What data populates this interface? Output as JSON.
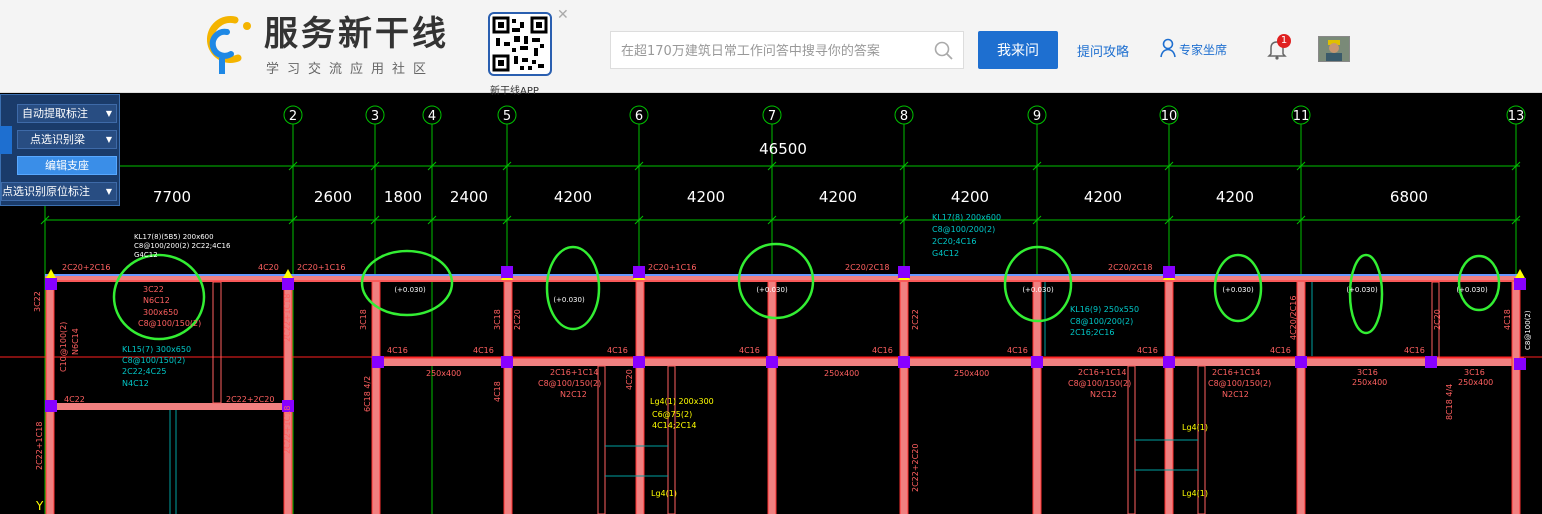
{
  "header": {
    "brand_name": "服务新干线",
    "brand_sub": "学习交流应用社区",
    "qr_label": "新干线APP",
    "search_placeholder": "在超170万建筑日常工作问答中搜寻你的答案",
    "ask_label": "我来问",
    "guide_label": "提问攻略",
    "expert_label": "专家坐席",
    "notify_count": "1"
  },
  "tool_panel": {
    "items": [
      {
        "label": "自动提取标注",
        "has_dropdown": true
      },
      {
        "label": "点选识别梁",
        "has_dropdown": true
      },
      {
        "label": "编辑支座",
        "has_dropdown": false
      },
      {
        "label": "点选识别原位标注",
        "has_dropdown": true
      }
    ]
  },
  "cad": {
    "colors": {
      "grid": "#00c000",
      "beam": "#ff3030",
      "beam_fill": "#f08080",
      "beam_top": "#6699ff",
      "support": "#ffff00",
      "column": "#8800ff",
      "circle": "#33ee33",
      "cyan": "#00c8c8"
    },
    "axes": [
      "2",
      "3",
      "4",
      "5",
      "6",
      "7",
      "8",
      "9",
      "10",
      "11",
      "13"
    ],
    "total_dim": "46500",
    "span_dims": [
      "7700",
      "2600",
      "1800",
      "2400",
      "4200",
      "4200",
      "4200",
      "4200",
      "4200",
      "4200",
      "6800"
    ],
    "top_labels": [
      "2C20+2C16",
      "4C20",
      "2C20+1C16",
      "2C20+1C16",
      "2C20/2C18",
      "2C20/2C18"
    ],
    "elevations": [
      "(+0.030)",
      "(+0.030)",
      "(+0.030)",
      "(+0.030)",
      "(+0.030)",
      "(+0.030)",
      "(+0.030)"
    ],
    "annot_left": [
      "3C22",
      "N6C12",
      "300x650",
      "C8@100/150(2)"
    ],
    "kl_top": [
      "KL17(8) 200x600",
      "C8@100/200(2)",
      "2C20;4C16",
      "G4C12"
    ],
    "kl_15": [
      "KL15(7) 300x650",
      "C8@100/150(2)",
      "2C22;4C25",
      "N4C12"
    ],
    "kl_16": [
      "KL16(9) 250x550",
      "C8@100/200(2)",
      "2C16;2C16"
    ],
    "kl_17": [
      "KL17(8)(5B5) 200x600",
      "C8@100/200(2) 2C22;4C16",
      "G4C12"
    ],
    "mid_labels": [
      "4C16",
      "4C16",
      "4C16",
      "4C16",
      "4C16",
      "4C16",
      "4C16",
      "4C16",
      "4C16"
    ],
    "section_labels": [
      "250x400",
      "250x400",
      "250x400",
      "250x400",
      "250x400"
    ],
    "mid_annots": [
      [
        "2C16+1C14",
        "C8@100/150(2)",
        "N2C12"
      ],
      [
        "2C16+1C14",
        "C8@100/150(2)",
        "N2C12"
      ],
      [
        "2C16+1C14",
        "C8@100/150(2)",
        "N2C12"
      ],
      [
        "3C16",
        "250x400"
      ],
      [
        "3C16",
        "250x400"
      ]
    ],
    "lg_labels": [
      "Lg4(1) 200x300",
      "C6@75(2)",
      "4C14;2C14",
      "Lg4(1)",
      "Lg4(1)",
      "Lg4(1)"
    ],
    "left_misc": [
      "4C22",
      "2C22+2C20",
      "3C22",
      "C10@100(2)",
      "N6C14"
    ],
    "vertical_labels": [
      "2C22+1C18",
      "3C18",
      "3C18",
      "2C20",
      "2C22",
      "2C22+2C20",
      "4C18",
      "4C20",
      "4C20/2C16",
      "2C20",
      "4C18",
      "8C18 4/4",
      "6C18 4/2",
      "2C22+1C18",
      "2C22+1C18",
      "C8@100(2)"
    ]
  }
}
